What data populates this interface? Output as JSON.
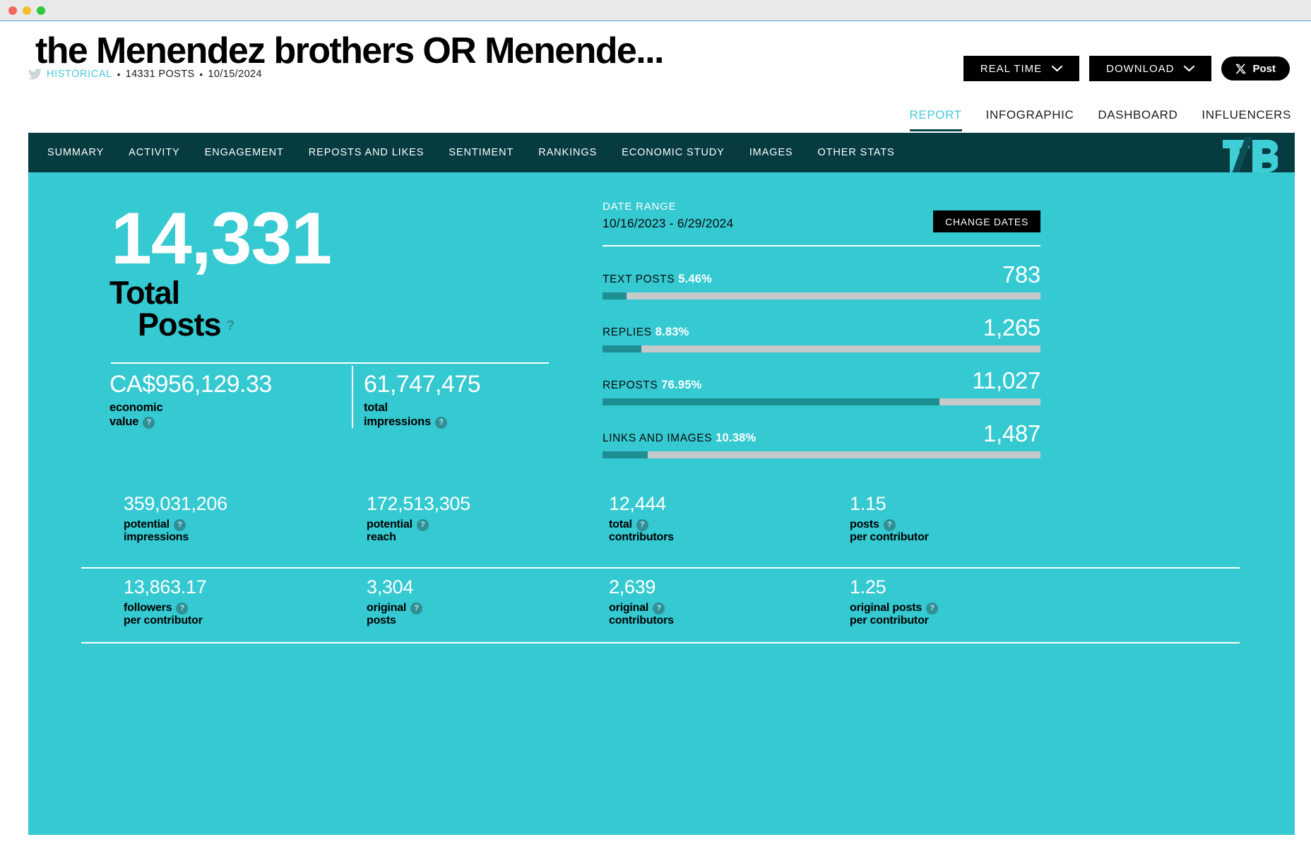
{
  "window": {
    "dots": [
      "close",
      "minimize",
      "maximize"
    ]
  },
  "header": {
    "title": "the Menendez brothers OR Menende...",
    "source_icon": "twitter-icon",
    "mode": "HISTORICAL",
    "posts": "14331 POSTS",
    "date": "10/15/2024",
    "bullet": "•"
  },
  "actions": {
    "realtime": "REAL TIME",
    "download": "DOWNLOAD",
    "post": "Post"
  },
  "view_tabs": [
    {
      "label": "REPORT",
      "active": true
    },
    {
      "label": "INFOGRAPHIC",
      "active": false
    },
    {
      "label": "DASHBOARD",
      "active": false
    },
    {
      "label": "INFLUENCERS",
      "active": false
    }
  ],
  "nav": {
    "items": [
      "SUMMARY",
      "ACTIVITY",
      "ENGAGEMENT",
      "REPOSTS AND LIKES",
      "SENTIMENT",
      "RANKINGS",
      "ECONOMIC STUDY",
      "IMAGES",
      "OTHER STATS"
    ],
    "logo": "TB"
  },
  "summary": {
    "total_posts_value": "14,331",
    "total_posts_label_line1": "Total",
    "total_posts_label_line2": "Posts",
    "help": "?",
    "kpis": [
      {
        "value": "CA$956,129.33",
        "label_line1": "economic",
        "label_line2": "value"
      },
      {
        "value": "61,747,475",
        "label_line1": "total",
        "label_line2": "impressions"
      }
    ]
  },
  "date_range": {
    "label": "DATE RANGE",
    "value": "10/16/2023 - 6/29/2024",
    "change_button": "CHANGE DATES"
  },
  "chart_data": {
    "type": "bar",
    "title": "Post type distribution",
    "orientation": "horizontal",
    "xlabel": "",
    "ylabel": "",
    "grid": false,
    "legend": "none",
    "categories": [
      "TEXT POSTS",
      "REPLIES",
      "REPOSTS",
      "LINKS AND IMAGES"
    ],
    "values": [
      783,
      1265,
      11027,
      1487
    ],
    "percent_labels": [
      "5.46%",
      "8.83%",
      "76.95%",
      "10.38%"
    ],
    "percent_values": [
      5.46,
      8.83,
      76.95,
      10.38
    ],
    "count_labels": [
      "783",
      "1,265",
      "11,027",
      "1,487"
    ],
    "fill_color": "#1d8e92",
    "track_color": "#c4c9c9",
    "xlim": [
      0,
      100
    ]
  },
  "stats_grid": {
    "row1": [
      {
        "value": "359,031,206",
        "label_line1": "potential",
        "label_line2": "impressions"
      },
      {
        "value": "172,513,305",
        "label_line1": "potential",
        "label_line2": "reach"
      },
      {
        "value": "12,444",
        "label_line1": "total",
        "label_line2": "contributors"
      },
      {
        "value": "1.15",
        "label_line1": "posts",
        "label_line2": "per contributor"
      }
    ],
    "row2": [
      {
        "value": "13,863.17",
        "label_line1": "followers",
        "label_line2": "per contributor"
      },
      {
        "value": "3,304",
        "label_line1": "original",
        "label_line2": "posts"
      },
      {
        "value": "2,639",
        "label_line1": "original",
        "label_line2": "contributors"
      },
      {
        "value": "1.25",
        "label_line1": "original posts",
        "label_line2": "per contributor"
      }
    ]
  },
  "colors": {
    "teal_body": "#35c9d2",
    "nav_dark": "#063b40",
    "accent": "#4ac9dd",
    "bar_fill": "#1d8e92"
  }
}
